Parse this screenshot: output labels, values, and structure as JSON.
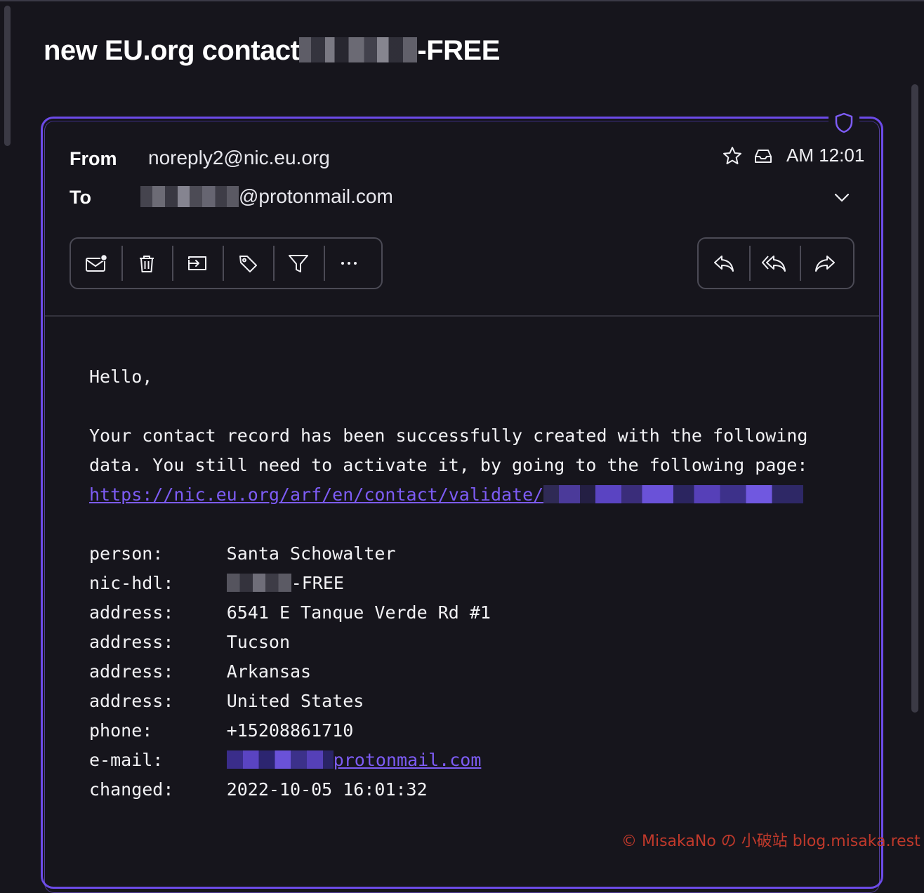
{
  "email": {
    "subject_prefix": "new EU.org contact",
    "subject_suffix": "-FREE",
    "from_label": "From",
    "from_value": "noreply2@nic.eu.org",
    "to_label": "To",
    "to_value_suffix": "@protonmail.com",
    "time": "AM 12:01"
  },
  "toolbar_left": {
    "icons": [
      "mark-unread-icon",
      "trash-icon",
      "move-to-folder-icon",
      "label-tag-icon",
      "filter-icon",
      "more-options-icon"
    ]
  },
  "toolbar_right": {
    "icons": [
      "reply-icon",
      "reply-all-icon",
      "forward-icon"
    ]
  },
  "body": {
    "greeting": "Hello,",
    "line1": "Your contact record has been successfully created with the following",
    "line2": "data. You still need to activate it, by going to the following page:",
    "link": "https://nic.eu.org/arf/en/contact/validate/",
    "fields": [
      {
        "key": "person:",
        "value": "Santa Schowalter"
      },
      {
        "key": "nic-hdl:",
        "value": "-FREE"
      },
      {
        "key": "address:",
        "value": "6541 E Tanque Verde Rd #1"
      },
      {
        "key": "address:",
        "value": "Tucson"
      },
      {
        "key": "address:",
        "value": "Arkansas"
      },
      {
        "key": "address:",
        "value": "United States"
      },
      {
        "key": "phone:",
        "value": "+15208861710"
      },
      {
        "key": "e-mail:",
        "value": "protonmail.com"
      },
      {
        "key": "changed:",
        "value": "2022-10-05 16:01:32"
      }
    ]
  },
  "watermark": "© MisakaNo の 小破站 blog.misaka.rest",
  "colors": {
    "background": "#16151c",
    "accent_border": "#6c4be8",
    "link": "#7d5cf5",
    "watermark": "#c0392b"
  }
}
